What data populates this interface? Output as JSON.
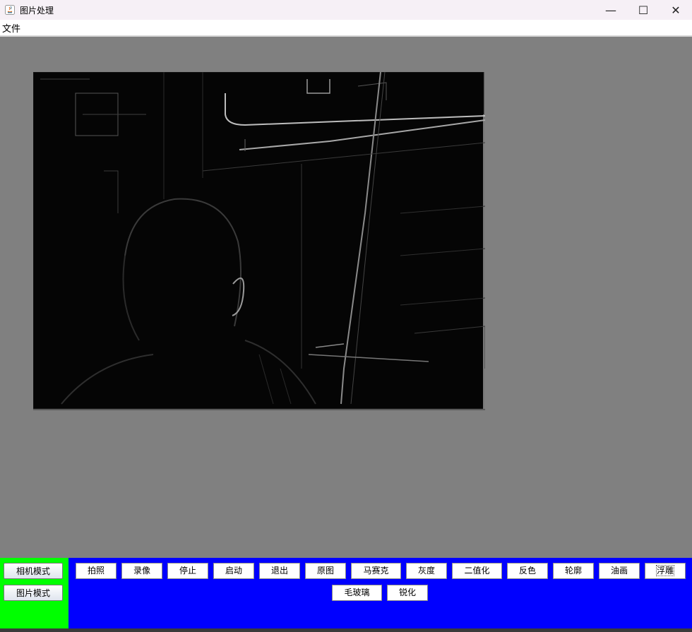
{
  "window": {
    "title": "图片处理",
    "controls": [
      "—",
      "☐",
      "✕"
    ]
  },
  "menu": {
    "items": [
      "文件"
    ]
  },
  "mode_buttons": [
    "相机模式",
    "图片模式"
  ],
  "toolbar": {
    "row1": [
      "拍照",
      "录像",
      "停止",
      "启动",
      "退出",
      "原图",
      "马赛克",
      "灰度",
      "二值化",
      "反色",
      "轮廓",
      "油画",
      "浮雕"
    ],
    "row2": [
      "毛玻璃",
      "锐化"
    ]
  },
  "colors": {
    "canvas_bg": "#808080",
    "left_panel": "#00ff00",
    "bottom_panel": "#0000ff"
  }
}
